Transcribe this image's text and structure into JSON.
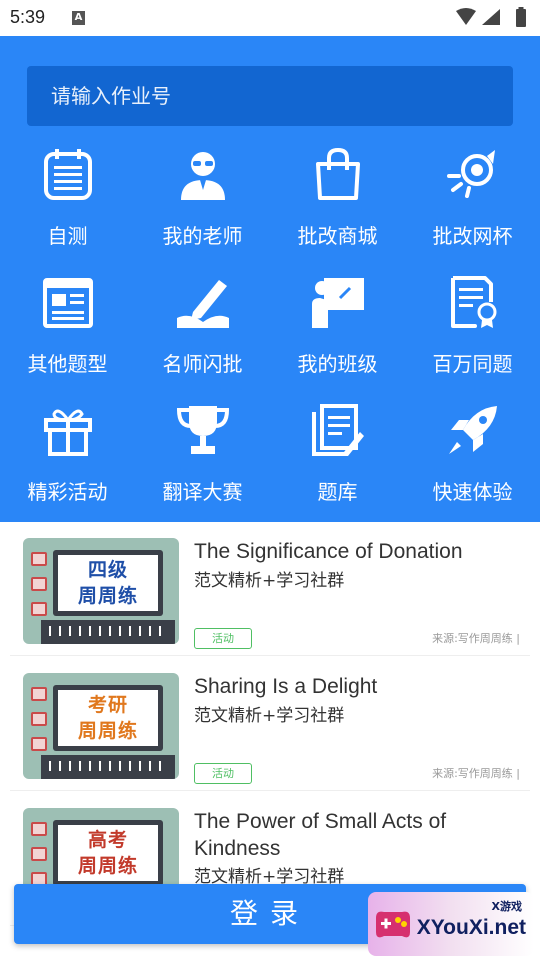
{
  "status": {
    "time": "5:39",
    "notification": "A"
  },
  "search": {
    "placeholder": "请输入作业号"
  },
  "menu": [
    {
      "label": "自测",
      "icon": "notebook-icon"
    },
    {
      "label": "我的老师",
      "icon": "teacher-icon"
    },
    {
      "label": "批改商城",
      "icon": "shopping-bag-icon"
    },
    {
      "label": "批改网杯",
      "icon": "award-icon"
    },
    {
      "label": "其他题型",
      "icon": "document-window-icon"
    },
    {
      "label": "名师闪批",
      "icon": "pencil-book-icon"
    },
    {
      "label": "我的班级",
      "icon": "classroom-icon"
    },
    {
      "label": "百万同题",
      "icon": "certificate-icon"
    },
    {
      "label": "精彩活动",
      "icon": "gift-icon"
    },
    {
      "label": "翻译大赛",
      "icon": "trophy-icon"
    },
    {
      "label": "题库",
      "icon": "question-bank-icon"
    },
    {
      "label": "快速体验",
      "icon": "rocket-icon"
    }
  ],
  "articles": [
    {
      "title": "The Significance of Donation",
      "subtitle": "范文精析+学习社群",
      "tag": "活动",
      "source": "来源:写作周周练 |",
      "thumb_line1": "四级",
      "thumb_line2": "周周练",
      "thumb_color": "#1f4fa8"
    },
    {
      "title": "Sharing Is a Delight",
      "subtitle": "范文精析+学习社群",
      "tag": "活动",
      "source": "来源:写作周周练 |",
      "thumb_line1": "考研",
      "thumb_line2": "周周练",
      "thumb_color": "#e0781e"
    },
    {
      "title": "The Power of Small Acts of Kindness",
      "subtitle": "范文精析+学习社群",
      "tag": "",
      "source": "",
      "thumb_line1": "高考",
      "thumb_line2": "周周练",
      "thumb_color": "#c23a2b"
    }
  ],
  "login": {
    "label": "登录"
  },
  "watermark": {
    "brand": "XYouXi.net",
    "small": "X游戏"
  }
}
